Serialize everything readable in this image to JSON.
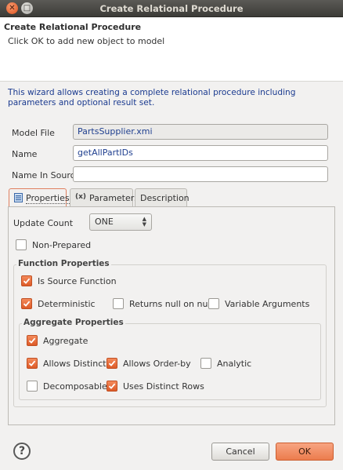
{
  "window": {
    "title": "Create Relational Procedure"
  },
  "header": {
    "title": "Create Relational Procedure",
    "message": "Click OK to add new object to model"
  },
  "intro": "This wizard allows creating a complete relational procedure including parameters and optional result set.",
  "form": {
    "model_file_label": "Model File",
    "model_file_value": "PartsSupplier.xmi",
    "name_label": "Name",
    "name_value": "getAllPartIDs",
    "name_in_source_label": "Name In Source",
    "name_in_source_value": ""
  },
  "tabs": [
    {
      "label": "Properties",
      "icon": "properties-icon",
      "active": true
    },
    {
      "label": "Parameters",
      "icon": "parameters-icon",
      "active": false
    },
    {
      "label": "Description",
      "active": false
    }
  ],
  "properties": {
    "update_count_label": "Update Count",
    "update_count_value": "ONE",
    "non_prepared": {
      "label": "Non-Prepared",
      "checked": false
    },
    "function_group": {
      "title": "Function Properties",
      "is_source_function": {
        "label": "Is Source Function",
        "checked": true
      },
      "deterministic": {
        "label": "Deterministic",
        "checked": true
      },
      "returns_null_on_null": {
        "label": "Returns null on null",
        "checked": false
      },
      "variable_arguments": {
        "label": "Variable Arguments",
        "checked": false
      },
      "aggregate_group": {
        "title": "Aggregate Properties",
        "aggregate": {
          "label": "Aggregate",
          "checked": true
        },
        "allows_distinct": {
          "label": "Allows Distinct",
          "checked": true
        },
        "allows_order_by": {
          "label": "Allows Order-by",
          "checked": true
        },
        "analytic": {
          "label": "Analytic",
          "checked": false
        },
        "decomposable": {
          "label": "Decomposable",
          "checked": false
        },
        "uses_distinct_rows": {
          "label": "Uses Distinct Rows",
          "checked": true
        }
      }
    }
  },
  "buttons": {
    "help": "?",
    "cancel": "Cancel",
    "ok": "OK"
  },
  "colors": {
    "accent": "#ec7c4d",
    "intro_text": "#1a3a8f",
    "field_text": "#1f3f8f"
  }
}
